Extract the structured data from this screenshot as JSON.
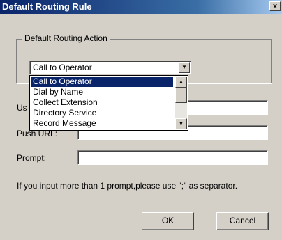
{
  "window": {
    "title": "Default Routing Rule",
    "close_glyph": "x"
  },
  "routing_action": {
    "group_label": "Default Routing Action",
    "selected_value": "Call to Operator",
    "options": [
      "Call to Operator",
      "Dial by Name",
      "Collect Extension",
      "Directory Service",
      "Record Message"
    ]
  },
  "fields": {
    "user_label_visible": "Us",
    "push_url_label": "Push URL:",
    "prompt_label": "Prompt:",
    "user_value": "",
    "push_url_value": "",
    "prompt_value": ""
  },
  "hint_text": "If you input more than 1 prompt,please use \";\" as separator.",
  "buttons": {
    "ok_label": "OK",
    "cancel_label": "Cancel"
  },
  "icons": {
    "dropdown_arrow": "chevron-down-icon",
    "scroll_up": "chevron-up-icon",
    "scroll_down": "chevron-down-icon"
  }
}
